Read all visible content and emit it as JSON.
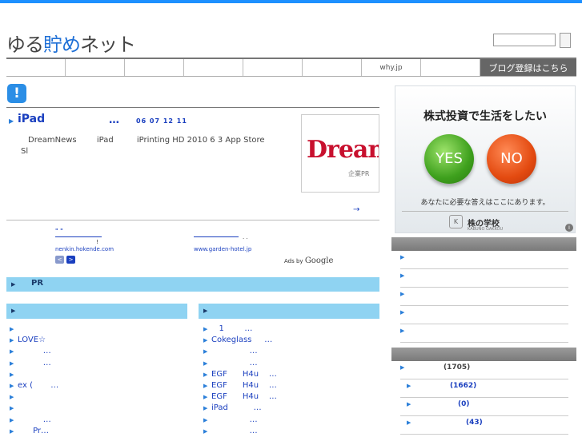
{
  "site": {
    "logo": "ゆる貯めネット",
    "logo_part1": "ゆる",
    "logo_part2": "貯め",
    "logo_part3": "ネット"
  },
  "nav": {
    "items": [
      "",
      "",
      "",
      "",
      "",
      "",
      "",
      "",
      "why.jp",
      ""
    ],
    "cta": "ブログ登録はこちら"
  },
  "notice": {
    "icon_glyph": "!"
  },
  "post": {
    "title": "iPad",
    "dots": "…",
    "date": "06 07 12 11",
    "body_1": "DreamNews",
    "body_2": "iPad",
    "body_3": "iPrinting HD  2010 6 3   App Store",
    "body_4": "Sl",
    "more": "→",
    "thumb_brand": "Dream",
    "thumb_sub": "企業PR"
  },
  "ads": {
    "left_title": "\"      \"",
    "left_sub": "!",
    "left_url": "nenkin.hokende.com",
    "right_sub": ".  .",
    "right_url": "www.garden-hotel.jp",
    "ads_by": "Ads by",
    "google": "Google",
    "prev": "<",
    "next": ">"
  },
  "pr_bar": {
    "label": "PR"
  },
  "left_list": [
    "",
    "LOVE☆",
    "          …",
    "          …",
    "",
    "ex (       …",
    "",
    "",
    "          …",
    "      Pr…"
  ],
  "right_list": [
    "   1        …",
    "Cokeglass     …",
    "               …",
    "               …",
    "EGF      H4u    …",
    "EGF      H4u    …",
    "EGF      H4u    …",
    "iPad          …",
    "               …",
    "               …"
  ],
  "banner": {
    "title": "株式投資で生活をしたい",
    "yes": "YES",
    "no": "NO",
    "sub": "あなたに必要な答えはここにあります。",
    "brand": "株の学校",
    "brand_sub": "KABUNO GAKKOU",
    "logo_glyph": "K",
    "info": "i"
  },
  "sidebar": {
    "section1_rows": [
      "",
      "",
      "",
      "",
      ""
    ],
    "section2_counts": [
      "(1705)",
      "(1662)",
      "(0)",
      "(43)"
    ]
  },
  "colors": {
    "accent_blue": "#1e90ff",
    "link": "#1a3fbf",
    "bar": "#8fd3f2",
    "side_head": "#888888"
  }
}
